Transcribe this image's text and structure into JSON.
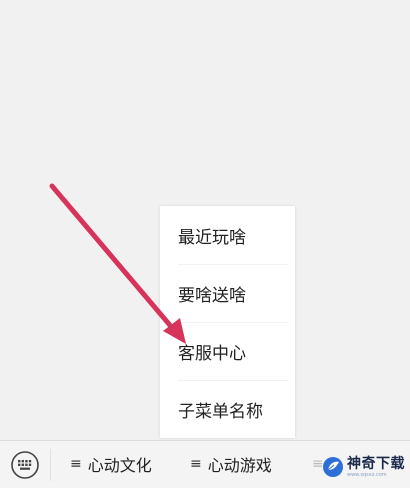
{
  "submenu": {
    "items": [
      {
        "label": "最近玩啥"
      },
      {
        "label": "要啥送啥"
      },
      {
        "label": "客服中心"
      },
      {
        "label": "子菜单名称"
      }
    ]
  },
  "menubar": {
    "keyboard_icon": "keyboard-icon",
    "tabs": [
      {
        "icon": "≡",
        "label": "心动文化"
      },
      {
        "icon": "≡",
        "label": "心动游戏"
      },
      {
        "icon": "≡",
        "label": ""
      }
    ]
  },
  "watermark": {
    "name": "神奇下载",
    "url": "www.sqsxz.com"
  },
  "colors": {
    "arrow": "#d6345a",
    "background": "#f1f1f1",
    "menubar": "#f4f4f4",
    "popup": "#ffffff"
  }
}
